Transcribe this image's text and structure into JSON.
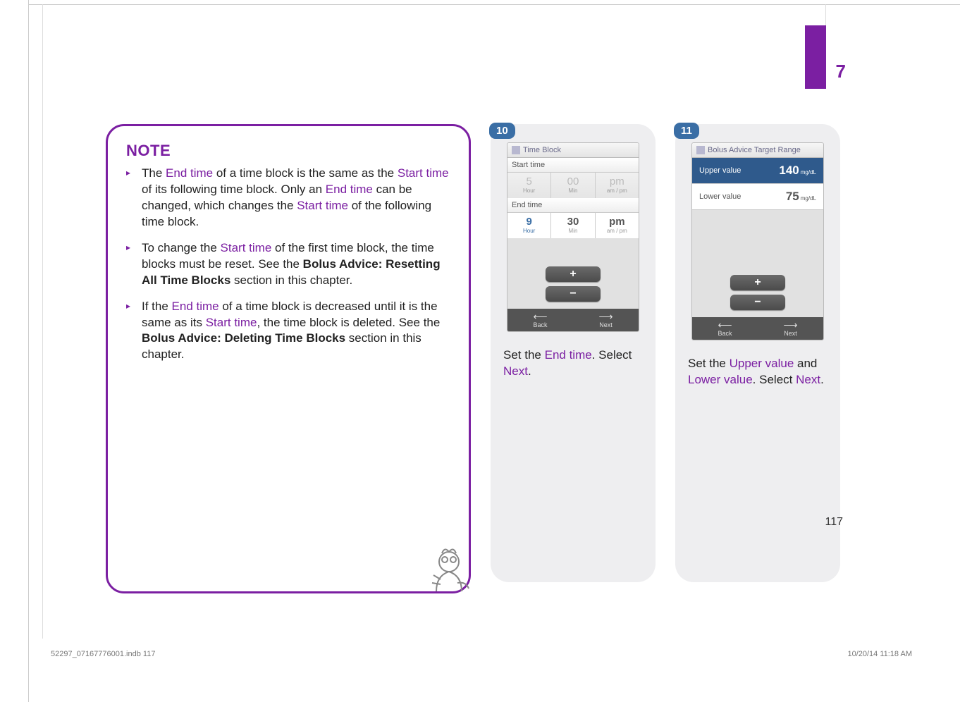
{
  "chapter": {
    "number": "7"
  },
  "page_number": "117",
  "slug": {
    "file": "52297_07167776001.indb   117",
    "stamp": "10/20/14   11:18 AM"
  },
  "note": {
    "title": "NOTE",
    "items": [
      {
        "pre": "The ",
        "t1": "End time",
        "mid1": " of a time block is the same as the ",
        "t2": "Start time",
        "mid2": " of its following time block. Only an ",
        "t3": "End time",
        "mid3": " can be changed, which changes the ",
        "t4": "Start time",
        "post": " of the following time block."
      },
      {
        "pre": "To change the ",
        "t1": "Start time",
        "mid1": " of the first time block, the time blocks must be reset. See the ",
        "b1": "Bolus Advice: Resetting All Time Blocks",
        "post": " section in this chapter."
      },
      {
        "pre": "If the ",
        "t1": "End time",
        "mid1": " of a time block is decreased until it is the same as its ",
        "t2": "Start time",
        "mid2": ", the time block is deleted. See the ",
        "b1": "Bolus Advice: Deleting Time Blocks",
        "post": " section in this chapter."
      }
    ]
  },
  "step10": {
    "badge": "10",
    "screen": {
      "title": "Time Block",
      "start_label": "Start time",
      "start": {
        "hour": "5",
        "hour_lbl": "Hour",
        "min": "00",
        "min_lbl": "Min",
        "ampm": "pm",
        "ampm_lbl": "am / pm"
      },
      "end_label": "End time",
      "end": {
        "hour": "9",
        "hour_lbl": "Hour",
        "min": "30",
        "min_lbl": "Min",
        "ampm": "pm",
        "ampm_lbl": "am / pm"
      },
      "plus": "+",
      "minus": "−",
      "back": "Back",
      "next": "Next"
    },
    "caption": {
      "pre": "Set the ",
      "t1": "End time",
      "mid": ". Select ",
      "t2": "Next",
      "post": "."
    }
  },
  "step11": {
    "badge": "11",
    "screen": {
      "title": "Bolus Advice Target Range",
      "upper": {
        "label": "Upper value",
        "num": "140",
        "unit": "mg/dL"
      },
      "lower": {
        "label": "Lower value",
        "num": "75",
        "unit": "mg/dL"
      },
      "plus": "+",
      "minus": "−",
      "back": "Back",
      "next": "Next"
    },
    "caption": {
      "pre": "Set the ",
      "t1": "Upper value",
      "mid": " and ",
      "t2": "Lower value",
      "mid2": ". Select ",
      "t3": "Next",
      "post": "."
    }
  }
}
